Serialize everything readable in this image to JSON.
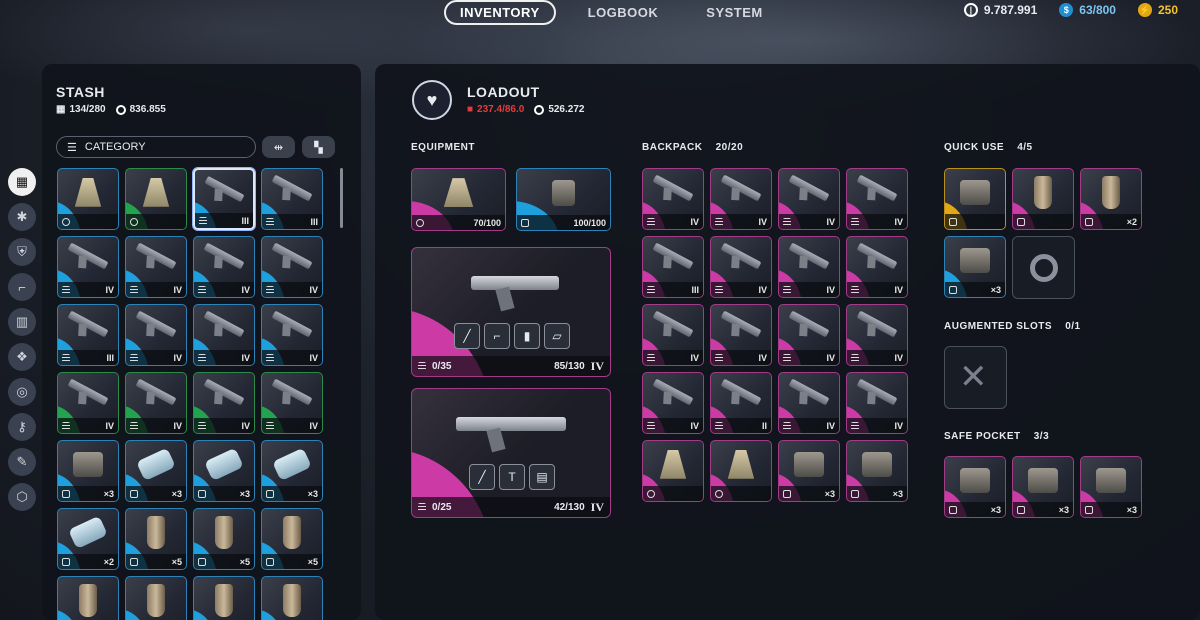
{
  "nav": {
    "tabs": [
      "INVENTORY",
      "LOGBOOK",
      "SYSTEM"
    ]
  },
  "currency": {
    "credits": "9.787.991",
    "capacity": "63/800",
    "tokens": "250"
  },
  "stash": {
    "title": "STASH",
    "slots": "134/280",
    "value": "836.855",
    "category_label": "CATEGORY",
    "side_icons": [
      "grid-icon",
      "consumable-icon",
      "shield-icon",
      "weapon-icon",
      "ammo-icon",
      "mod-icon",
      "ring-icon",
      "key-icon",
      "wrench-icon",
      "cube-icon"
    ],
    "items": [
      {
        "rarity": "blue",
        "kind": "pack",
        "tier": ""
      },
      {
        "rarity": "green",
        "kind": "pack",
        "tier": ""
      },
      {
        "rarity": "blue",
        "kind": "gun",
        "tier": "III"
      },
      {
        "rarity": "blue",
        "kind": "gun",
        "tier": "III"
      },
      {
        "rarity": "blue",
        "kind": "gun",
        "tier": "IV"
      },
      {
        "rarity": "blue",
        "kind": "gun",
        "tier": "IV"
      },
      {
        "rarity": "blue",
        "kind": "gun",
        "tier": "IV"
      },
      {
        "rarity": "blue",
        "kind": "gun",
        "tier": "IV"
      },
      {
        "rarity": "blue",
        "kind": "gun",
        "tier": "III"
      },
      {
        "rarity": "blue",
        "kind": "gun",
        "tier": "IV"
      },
      {
        "rarity": "blue",
        "kind": "gun",
        "tier": "IV"
      },
      {
        "rarity": "blue",
        "kind": "gun",
        "tier": "IV"
      },
      {
        "rarity": "green",
        "kind": "gun",
        "tier": "IV"
      },
      {
        "rarity": "green",
        "kind": "gun",
        "tier": "IV"
      },
      {
        "rarity": "green",
        "kind": "gun",
        "tier": "IV"
      },
      {
        "rarity": "green",
        "kind": "gun",
        "tier": "IV"
      },
      {
        "rarity": "blue",
        "kind": "box",
        "tier": "×3"
      },
      {
        "rarity": "blue",
        "kind": "bag",
        "tier": "×3"
      },
      {
        "rarity": "blue",
        "kind": "bag",
        "tier": "×3"
      },
      {
        "rarity": "blue",
        "kind": "bag",
        "tier": "×3"
      },
      {
        "rarity": "blue",
        "kind": "bag",
        "tier": "×2"
      },
      {
        "rarity": "blue",
        "kind": "can",
        "tier": "×5"
      },
      {
        "rarity": "blue",
        "kind": "can",
        "tier": "×5"
      },
      {
        "rarity": "blue",
        "kind": "can",
        "tier": "×5"
      },
      {
        "rarity": "blue",
        "kind": "can",
        "tier": ""
      },
      {
        "rarity": "blue",
        "kind": "can",
        "tier": ""
      },
      {
        "rarity": "blue",
        "kind": "can",
        "tier": ""
      },
      {
        "rarity": "blue",
        "kind": "can",
        "tier": ""
      }
    ]
  },
  "loadout": {
    "title": "LOADOUT",
    "weight": "237.4/86.0",
    "value": "526.272",
    "equipment": {
      "label": "EQUIPMENT",
      "slot1": "70/100",
      "slot2": "100/100",
      "weapon1": {
        "ammo": "0/35",
        "durability": "85/130",
        "tier": "IV"
      },
      "weapon2": {
        "ammo": "0/25",
        "durability": "42/130",
        "tier": "IV"
      }
    },
    "backpack": {
      "label": "BACKPACK",
      "count": "20/20",
      "items": [
        {
          "kind": "gun",
          "tier": "IV"
        },
        {
          "kind": "gun",
          "tier": "IV"
        },
        {
          "kind": "gun",
          "tier": "IV"
        },
        {
          "kind": "gun",
          "tier": "IV"
        },
        {
          "kind": "gun",
          "tier": "III"
        },
        {
          "kind": "gun",
          "tier": "IV"
        },
        {
          "kind": "gun",
          "tier": "IV"
        },
        {
          "kind": "gun",
          "tier": "IV"
        },
        {
          "kind": "gun",
          "tier": "IV"
        },
        {
          "kind": "gun",
          "tier": "IV"
        },
        {
          "kind": "gun",
          "tier": "IV"
        },
        {
          "kind": "gun",
          "tier": "IV"
        },
        {
          "kind": "gun",
          "tier": "IV"
        },
        {
          "kind": "gun",
          "tier": "II"
        },
        {
          "kind": "gun",
          "tier": "IV"
        },
        {
          "kind": "gun",
          "tier": "IV"
        },
        {
          "kind": "pack",
          "tier": ""
        },
        {
          "kind": "pack",
          "tier": ""
        },
        {
          "kind": "box",
          "tier": "×3"
        },
        {
          "kind": "box",
          "tier": "×3"
        }
      ]
    },
    "quick_use": {
      "label": "QUICK USE",
      "count": "4/5",
      "items": [
        {
          "rarity": "gold",
          "kind": "box",
          "tier": ""
        },
        {
          "rarity": "pink",
          "kind": "can",
          "tier": ""
        },
        {
          "rarity": "pink",
          "kind": "can",
          "tier": "×2"
        },
        {
          "rarity": "blue",
          "kind": "box",
          "tier": "×3"
        }
      ]
    },
    "augmented": {
      "label": "AUGMENTED SLOTS",
      "count": "0/1"
    },
    "safe_pocket": {
      "label": "SAFE POCKET",
      "count": "3/3",
      "items": [
        {
          "rarity": "pink",
          "kind": "box",
          "tier": "×3"
        },
        {
          "rarity": "pink",
          "kind": "box",
          "tier": "×3"
        },
        {
          "rarity": "pink",
          "kind": "box",
          "tier": "×3"
        }
      ]
    }
  },
  "colors": {
    "blue": "#1fa0de",
    "green": "#22a44f",
    "pink": "#cb3aa5",
    "gold": "#e2a715",
    "weight_red": "#e23b3b"
  }
}
